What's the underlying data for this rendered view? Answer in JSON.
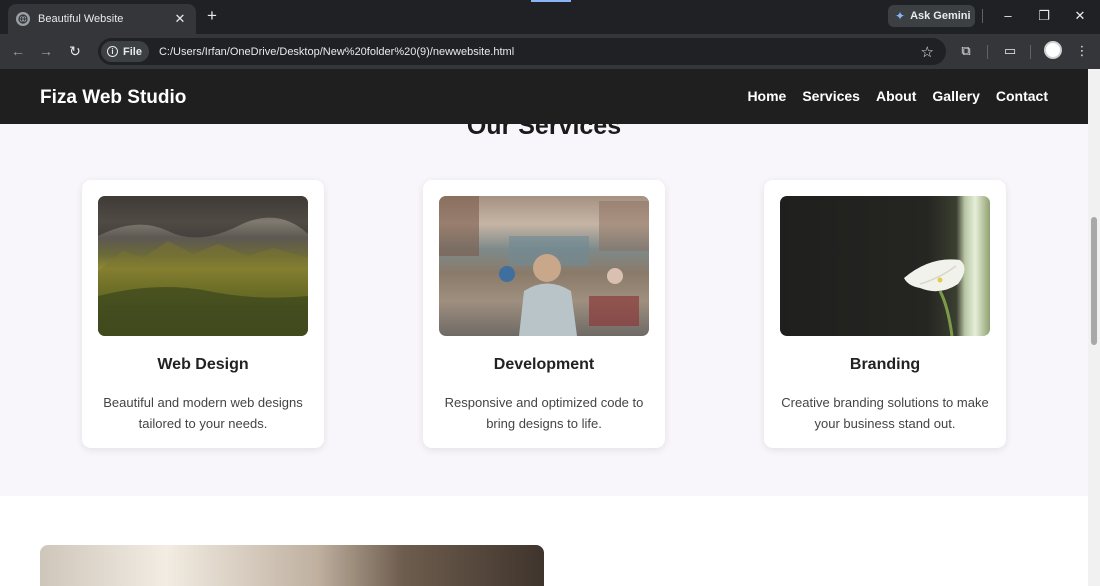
{
  "browser": {
    "tab": {
      "title": "Beautiful Website"
    },
    "gemini_label": "Ask Gemini",
    "address": {
      "chip_label": "File",
      "url": "C:/Users/Irfan/OneDrive/Desktop/New%20folder%20(9)/newwebsite.html"
    },
    "icons": [
      "globe-icon",
      "close-icon",
      "plus-icon",
      "sparkle-icon",
      "minimize-icon",
      "restore-icon",
      "back-arrow-icon",
      "forward-arrow-icon",
      "reload-icon",
      "info-icon",
      "star-icon",
      "extensions-icon",
      "cast-icon",
      "avatar",
      "more-icon"
    ]
  },
  "site": {
    "brand": "Fiza Web Studio",
    "nav": [
      "Home",
      "Services",
      "About",
      "Gallery",
      "Contact"
    ]
  },
  "services": {
    "heading": "Our Services",
    "cards": [
      {
        "title": "Web Design",
        "description": "Beautiful and modern web designs tailored to your needs."
      },
      {
        "title": "Development",
        "description": "Responsive and optimized code to bring designs to life."
      },
      {
        "title": "Branding",
        "description": "Creative branding solutions to make your business stand out."
      }
    ]
  },
  "colors": {
    "header_bg": "#1f1f20",
    "section_bg": "#f8f6fa",
    "card_bg": "#ffffff",
    "accent": "#8ab4f8"
  }
}
